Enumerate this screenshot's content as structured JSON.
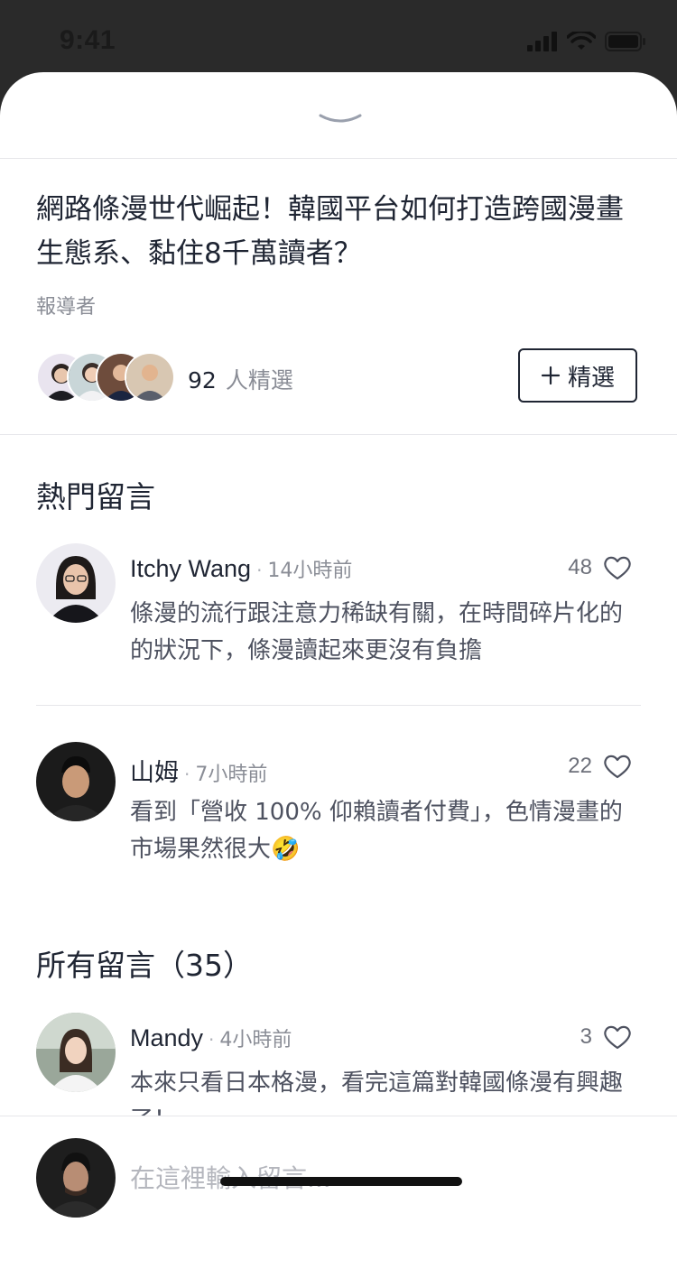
{
  "status": {
    "time": "9:41"
  },
  "article": {
    "title": "網路條漫世代崛起！韓國平台如何打造跨國漫畫生態系、黏住8千萬讀者？",
    "byline": "報導者",
    "picks_count": "92",
    "picks_label": "人精選",
    "pick_button_label": "精選"
  },
  "hot": {
    "title": "熱門留言",
    "comments": [
      {
        "name": "Itchy Wang",
        "time": "14小時前",
        "likes": "48",
        "text": "條漫的流行跟注意力稀缺有關，在時間碎片化的的狀況下，條漫讀起來更沒有負擔"
      },
      {
        "name": "山姆",
        "time": "7小時前",
        "likes": "22",
        "text": "看到「營收 100% 仰賴讀者付費」，色情漫畫的市場果然很大🤣"
      }
    ]
  },
  "all": {
    "title": "所有留言（35）",
    "comments": [
      {
        "name": "Mandy",
        "time": "4小時前",
        "likes": "3",
        "text": "本來只看日本格漫，看完這篇對韓國條漫有興趣了！"
      }
    ]
  },
  "composer": {
    "placeholder": "在這裡輸入留言..."
  },
  "icons": {
    "handle": "chevron-down-icon",
    "like": "heart-icon",
    "plus": "plus-icon",
    "signal": "signal-icon",
    "wifi": "wifi-icon",
    "battery": "battery-icon"
  },
  "colors": {
    "text_primary": "#1f2533",
    "text_secondary": "#8a8d96",
    "divider": "#e6e6ea",
    "status_bar": "#2a2a2a"
  }
}
